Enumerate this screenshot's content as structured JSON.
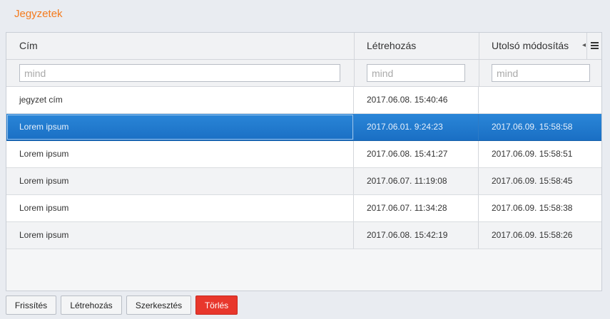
{
  "panel": {
    "title": "Jegyzetek"
  },
  "columns": [
    {
      "label": "Cím"
    },
    {
      "label": "Létrehozás"
    },
    {
      "label": "Utolsó módosítás"
    }
  ],
  "filters": [
    {
      "placeholder": "mind"
    },
    {
      "placeholder": "mind"
    },
    {
      "placeholder": "mind"
    }
  ],
  "rows": [
    {
      "title": "jegyzet cím",
      "created": "2017.06.08. 15:40:46",
      "modified": ""
    },
    {
      "title": "Lorem ipsum",
      "created": "2017.06.01. 9:24:23",
      "modified": "2017.06.09. 15:58:58",
      "selected": true
    },
    {
      "title": "Lorem ipsum",
      "created": "2017.06.08. 15:41:27",
      "modified": "2017.06.09. 15:58:51"
    },
    {
      "title": "Lorem ipsum",
      "created": "2017.06.07. 11:19:08",
      "modified": "2017.06.09. 15:58:45"
    },
    {
      "title": "Lorem ipsum",
      "created": "2017.06.07. 11:34:28",
      "modified": "2017.06.09. 15:58:38"
    },
    {
      "title": "Lorem ipsum",
      "created": "2017.06.08. 15:42:19",
      "modified": "2017.06.09. 15:58:26"
    }
  ],
  "toolbar": {
    "refresh_label": "Frissítés",
    "create_label": "Létrehozás",
    "edit_label": "Szerkesztés",
    "delete_label": "Törlés"
  },
  "icons": {
    "column_menu": "menu-icon",
    "sort": "sort-arrow-icon"
  },
  "colors": {
    "accent": "#f47b1e",
    "selection": "#1a6fc4",
    "danger": "#e8372c"
  }
}
